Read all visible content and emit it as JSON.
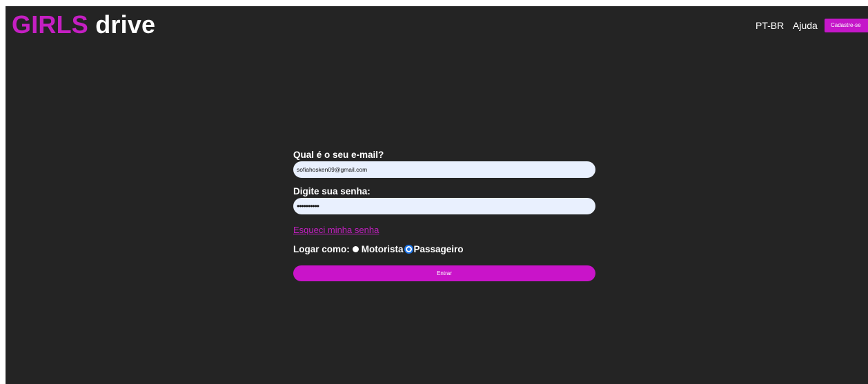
{
  "header": {
    "logo": {
      "accent_text": "GIRLS",
      "text": " drive"
    },
    "language": "PT-BR",
    "help": "Ajuda",
    "signup_button": "Cadastre-se"
  },
  "login_form": {
    "email_label": "Qual é o seu e-mail?",
    "email_value": "sofiahosken09@gmail.com",
    "password_label": "Digite sua senha:",
    "password_value": "••••••••••",
    "forgot_password": "Esqueci minha senha",
    "login_as": {
      "label": "Logar como:",
      "options": [
        {
          "label": "Motorista",
          "selected": false
        },
        {
          "label": "Passageiro",
          "selected": true
        }
      ]
    },
    "submit_button": "Entrar"
  },
  "colors": {
    "brand": "#c51fc3",
    "background": "#242424",
    "input_fill": "#e9f0fe",
    "radio_selected": "#1a73e8"
  },
  "icons": {
    "radio_unselected": "radio-unselected-icon",
    "radio_selected": "radio-selected-icon"
  }
}
